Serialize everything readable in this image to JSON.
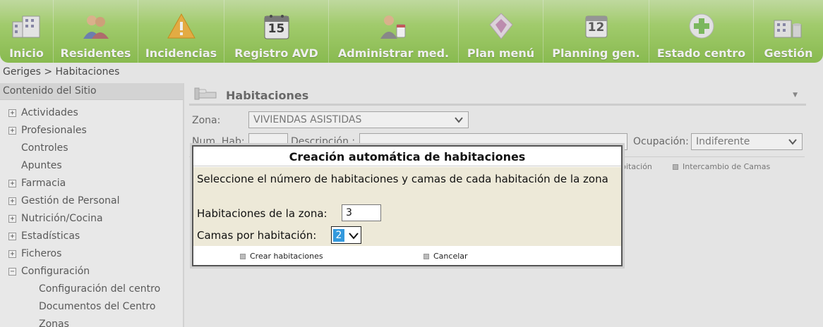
{
  "nav": {
    "items": [
      {
        "label": "Inicio",
        "icon": "building-icon"
      },
      {
        "label": "Residentes",
        "icon": "residents-icon"
      },
      {
        "label": "Incidencias",
        "icon": "warning-icon"
      },
      {
        "label": "Registro AVD",
        "icon": "calendar-icon"
      },
      {
        "label": "Administrar med.",
        "icon": "medication-icon"
      },
      {
        "label": "Plan menú",
        "icon": "menu-plan-icon"
      },
      {
        "label": "Planning gen.",
        "icon": "calendar-12-icon"
      },
      {
        "label": "Estado centro",
        "icon": "health-cross-icon"
      },
      {
        "label": "Gestión",
        "icon": "management-icon"
      }
    ],
    "calendar_day": "15",
    "calendar_day_2": "12"
  },
  "breadcrumb": "Geriges > Habitaciones",
  "sidebar": {
    "header": "Contenido del Sitio",
    "items": [
      {
        "label": "Actividades",
        "toggle": "+"
      },
      {
        "label": "Profesionales",
        "toggle": "+"
      },
      {
        "label": "Controles",
        "toggle": ""
      },
      {
        "label": "Apuntes",
        "toggle": ""
      },
      {
        "label": "Farmacia",
        "toggle": "+"
      },
      {
        "label": "Gestión de Personal",
        "toggle": "+"
      },
      {
        "label": "Nutrición/Cocina",
        "toggle": "+"
      },
      {
        "label": "Estadísticas",
        "toggle": "+"
      },
      {
        "label": "Ficheros",
        "toggle": "+"
      },
      {
        "label": "Configuración",
        "toggle": "−"
      }
    ],
    "subitems": [
      {
        "label": "Configuración del centro"
      },
      {
        "label": "Documentos del Centro"
      },
      {
        "label": "Zonas"
      }
    ]
  },
  "panel": {
    "title": "Habitaciones",
    "zona_label": "Zona:",
    "zona_value": "VIVIENDAS ASISTIDAS",
    "num_hab_label": "Num. Hab:",
    "descripcion_label": "Descripción :",
    "ocupacion_label": "Ocupación:",
    "ocupacion_value": "Indiferente",
    "link_habitacion": "bitación",
    "link_intercambio": "Intercambio de Camas"
  },
  "modal": {
    "title": "Creación automática de habitaciones",
    "text": "Seleccione el número de habitaciones y camas de cada habitación de la zona",
    "habitaciones_label": "Habitaciones de la zona:",
    "habitaciones_value": "3",
    "camas_label": "Camas por habitación:",
    "camas_value": "2",
    "crear_label": "Crear habitaciones",
    "cancelar_label": "Cancelar"
  },
  "colors": {
    "nav_green": "#8bc34a",
    "modal_body": "#ede9d8",
    "select_highlight": "#3399dd"
  }
}
